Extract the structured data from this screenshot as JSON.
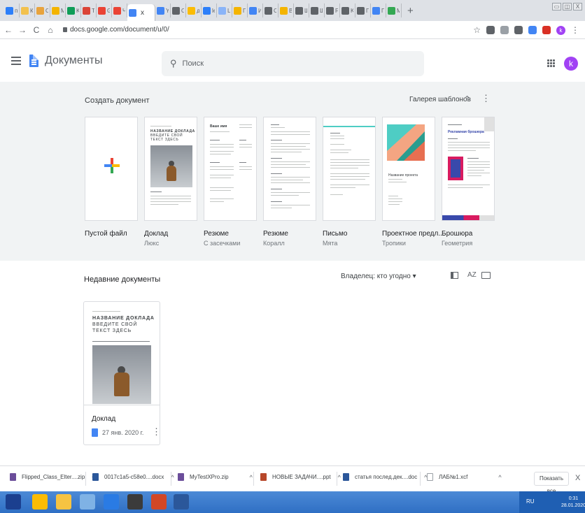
{
  "browser": {
    "tabs": [
      {
        "title": "пр",
        "color": "#2d7ff9"
      },
      {
        "title": "Ка",
        "color": "#f2c14e"
      },
      {
        "title": "Of",
        "color": "#e8a33d"
      },
      {
        "title": "Мс",
        "color": "#f4b400"
      },
      {
        "title": "Ka",
        "color": "#0f9d58"
      },
      {
        "title": "Te",
        "color": "#db4437"
      },
      {
        "title": "Gr",
        "color": "#ea4335"
      },
      {
        "title": "Чe",
        "color": "#ea4335"
      }
    ],
    "active_tab": {
      "title": "",
      "close": "x"
    },
    "tabs_after": [
      {
        "title": "Ys",
        "color": "#4285f4"
      },
      {
        "title": "Of",
        "color": "#5f6368"
      },
      {
        "title": "дз",
        "color": "#fbbc04"
      },
      {
        "title": "lea",
        "color": "#2d7ff9"
      },
      {
        "title": "Las",
        "color": "#8ab4f8"
      },
      {
        "title": "Пе",
        "color": "#f4b400"
      },
      {
        "title": "Ис",
        "color": "#4285f4"
      },
      {
        "title": "Св",
        "color": "#5f6368"
      },
      {
        "title": "Вх",
        "color": "#f4b400"
      },
      {
        "title": "Ш",
        "color": "#5f6368"
      },
      {
        "title": "Ш",
        "color": "#5f6368"
      },
      {
        "title": "Fo",
        "color": "#5f6368"
      },
      {
        "title": "Ka",
        "color": "#5f6368"
      },
      {
        "title": "Гл",
        "color": "#5f6368"
      },
      {
        "title": "По",
        "color": "#4285f4"
      },
      {
        "title": "Mc",
        "color": "#34a853"
      }
    ],
    "new_tab": "+",
    "window_controls": {
      "minimize": "▭",
      "restore": "◫",
      "close": "X"
    },
    "url": "docs.google.com/document/u/0/",
    "nav": {
      "back": "←",
      "forward": "→",
      "reload": "C",
      "home": "⌂"
    },
    "profile_initial": "k",
    "extensions": [
      {
        "name": "extension-1",
        "color": "#5f6368"
      },
      {
        "name": "extension-2",
        "color": "#9aa0a6"
      },
      {
        "name": "extension-3",
        "color": "#5f6368"
      },
      {
        "name": "extension-4",
        "color": "#4285f4"
      },
      {
        "name": "extension-5",
        "color": "#d93025"
      }
    ]
  },
  "docs_header": {
    "app_name": "Документы",
    "search_placeholder": "Поиск",
    "user_initial": "k"
  },
  "gallery": {
    "title": "Создать документ",
    "gallery_link": "Галерея шаблонов",
    "toggle_icon": "⌃⌄",
    "more_icon": "⋮",
    "templates": [
      {
        "name": "Пустой файл",
        "subtitle": ""
      },
      {
        "name": "Доклад",
        "subtitle": "Люкс"
      },
      {
        "name": "Резюме",
        "subtitle": "С засечками"
      },
      {
        "name": "Резюме",
        "subtitle": "Коралл"
      },
      {
        "name": "Письмо",
        "subtitle": "Мята"
      },
      {
        "name": "Проектное предл...",
        "subtitle": "Тропики"
      },
      {
        "name": "Брошюра",
        "subtitle": "Геометрия"
      }
    ],
    "report_thumb": {
      "line1": "НАЗВАНИЕ ДОКЛАДА",
      "line2": "ВВЕДИТЕ СВОЙ",
      "line3": "ТЕКСТ ЗДЕСЬ"
    },
    "resume_thumb_title": "Ваше имя",
    "project_thumb_title": "Название проекта",
    "brochure_thumb_title": "Рекламная брошюра"
  },
  "recent": {
    "title": "Недавние документы",
    "owner_filter": "Владелец: кто угодно ▾",
    "sort_label": "AZ",
    "doc": {
      "title": "Доклад",
      "date": "27 янв. 2020 г.",
      "more": "⋮",
      "thumb": {
        "line1": "НАЗВАНИЕ ДОКЛАДА",
        "line2": "ВВЕДИТЕ СВОЙ",
        "line3": "ТЕКСТ ЗДЕСЬ"
      }
    }
  },
  "downloads": {
    "items": [
      {
        "name": "Flipped_Class_Elter....zip",
        "chev": "^",
        "color": "#6b4d9a"
      },
      {
        "name": "0017c1a5-c58e0....docx",
        "chev": "^",
        "color": "#2b579a"
      },
      {
        "name": "MyTestXPro.zip",
        "chev": "^",
        "color": "#6b4d9a"
      },
      {
        "name": "НОВЫЕ ЗАДАЧИ....ppt",
        "chev": "^",
        "color": "#b7472a"
      },
      {
        "name": "статья послед.дек....doc",
        "chev": "^",
        "color": "#2b579a"
      },
      {
        "name": "ЛАБ№1.xcf",
        "chev": "^",
        "color": "#ffffff"
      }
    ],
    "show_all": "Показать все",
    "close": "X"
  },
  "taskbar": {
    "language": "RU",
    "time": "0:31",
    "date": "28.01.2020",
    "apps": [
      {
        "name": "start-button",
        "color": "#1b3f8f"
      },
      {
        "name": "chrome-app",
        "color": "#fbbc04"
      },
      {
        "name": "explorer-app",
        "color": "#f6c342"
      },
      {
        "name": "app-4",
        "color": "#7fb2e5"
      },
      {
        "name": "app-5",
        "color": "#2a7be4"
      },
      {
        "name": "app-6",
        "color": "#3b3b3b"
      },
      {
        "name": "powerpoint-app",
        "color": "#d24726"
      },
      {
        "name": "word-app",
        "color": "#2b579a"
      }
    ]
  }
}
